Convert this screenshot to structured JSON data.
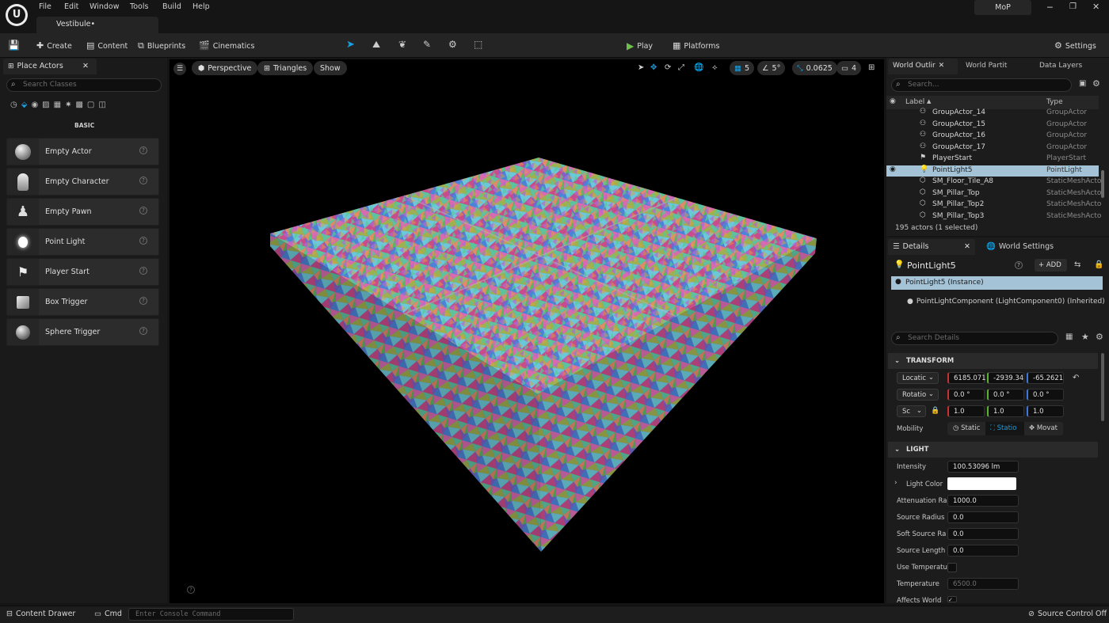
{
  "menu": {
    "items": [
      "File",
      "Edit",
      "Window",
      "Tools",
      "Build",
      "Help"
    ],
    "project": "MoP"
  },
  "document_tab": "Vestibule•",
  "toolbar": {
    "create": "Create",
    "content": "Content",
    "blueprints": "Blueprints",
    "cinematics": "Cinematics",
    "play": "Play",
    "platforms": "Platforms",
    "settings": "Settings"
  },
  "left_panel": {
    "tab": "Place Actors",
    "search_placeholder": "Search Classes",
    "category": "BASIC",
    "items": [
      {
        "label": "Empty Actor",
        "icon": "sphere-icon"
      },
      {
        "label": "Empty Character",
        "icon": "character-icon"
      },
      {
        "label": "Empty Pawn",
        "icon": "pawn-icon"
      },
      {
        "label": "Point Light",
        "icon": "bulb-icon"
      },
      {
        "label": "Player Start",
        "icon": "flag-icon"
      },
      {
        "label": "Box Trigger",
        "icon": "box-icon"
      },
      {
        "label": "Sphere Trigger",
        "icon": "sphere-icon"
      }
    ]
  },
  "viewport": {
    "perspective": "Perspective",
    "view_mode": "Triangles",
    "show": "Show",
    "grid_snap": "5",
    "rot_snap": "5°",
    "scale_snap": "0.0625",
    "camera_speed": "4"
  },
  "outliner": {
    "tabs": [
      "World Outlir",
      "World Partit",
      "Data Layers"
    ],
    "search_placeholder": "Search...",
    "col_label": "Label",
    "col_type": "Type",
    "rows": [
      {
        "name": "GroupActor_14",
        "type": "GroupActor",
        "icon": "group-icon"
      },
      {
        "name": "GroupActor_15",
        "type": "GroupActor",
        "icon": "group-icon"
      },
      {
        "name": "GroupActor_16",
        "type": "GroupActor",
        "icon": "group-icon"
      },
      {
        "name": "GroupActor_17",
        "type": "GroupActor",
        "icon": "group-icon"
      },
      {
        "name": "PlayerStart",
        "type": "PlayerStart",
        "icon": "flag-icon"
      },
      {
        "name": "PointLight5",
        "type": "PointLight",
        "icon": "bulb-icon",
        "selected": true
      },
      {
        "name": "SM_Floor_Tile_A8",
        "type": "StaticMeshActo",
        "icon": "mesh-icon"
      },
      {
        "name": "SM_Pillar_Top",
        "type": "StaticMeshActo",
        "icon": "mesh-icon"
      },
      {
        "name": "SM_Pillar_Top2",
        "type": "StaticMeshActo",
        "icon": "mesh-icon"
      },
      {
        "name": "SM_Pillar_Top3",
        "type": "StaticMeshActo",
        "icon": "mesh-icon"
      }
    ],
    "status": "195 actors (1 selected)"
  },
  "details": {
    "tabs": [
      "Details",
      "World Settings"
    ],
    "actor_name": "PointLight5",
    "add": "ADD",
    "components": [
      "PointLight5 (Instance)",
      "PointLightComponent (LightComponent0) (Inherited)"
    ],
    "search_placeholder": "Search Details",
    "transform": {
      "header": "TRANSFORM",
      "location_label": "Locatic",
      "location": [
        "6185.071",
        "-2939.34",
        "-65.2621"
      ],
      "rotation_label": "Rotatio",
      "rotation": [
        "0.0 °",
        "0.0 °",
        "0.0 °"
      ],
      "scale_label": "Sc",
      "scale": [
        "1.0",
        "1.0",
        "1.0"
      ],
      "mobility_label": "Mobility",
      "mobility": [
        "Static",
        "Statio",
        "Movat"
      ]
    },
    "light": {
      "header": "LIGHT",
      "props": [
        {
          "label": "Intensity",
          "value": "100.53096 lm"
        },
        {
          "label": "Light Color",
          "value": ""
        },
        {
          "label": "Attenuation Ra",
          "value": "1000.0"
        },
        {
          "label": "Source Radius",
          "value": "0.0"
        },
        {
          "label": "Soft Source Ra",
          "value": "0.0"
        },
        {
          "label": "Source Length",
          "value": "0.0"
        },
        {
          "label": "Use Temperatu",
          "value": ""
        },
        {
          "label": "Temperature",
          "value": "6500.0"
        },
        {
          "label": "Affects World",
          "value": ""
        }
      ]
    }
  },
  "statusbar": {
    "content_drawer": "Content Drawer",
    "cmd": "Cmd",
    "console_placeholder": "Enter Console Command",
    "source_control": "Source Control Off"
  },
  "colors": {
    "accent_blue": "#1a9fe0",
    "play_green": "#6fc04b",
    "selection": "#a5c3d6",
    "x_axis": "#c83232",
    "y_axis": "#5ab432",
    "z_axis": "#3c78dc"
  }
}
